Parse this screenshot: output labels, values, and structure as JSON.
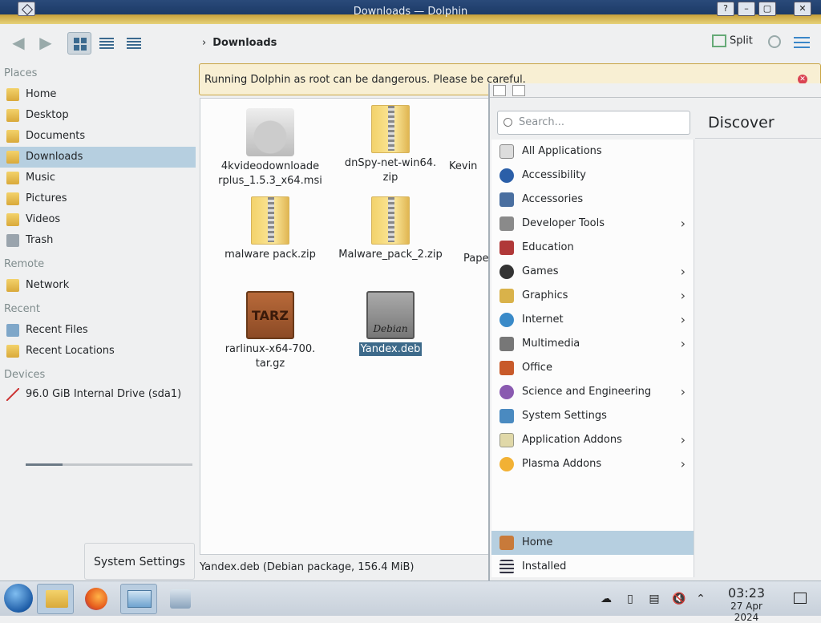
{
  "window": {
    "title": "Downloads — Dolphin"
  },
  "toolbar": {
    "breadcrumb": "Downloads",
    "split_label": "Split"
  },
  "sidebar": {
    "sections": [
      "Places",
      "Remote",
      "Recent",
      "Devices"
    ],
    "places": [
      "Home",
      "Desktop",
      "Documents",
      "Downloads",
      "Music",
      "Pictures",
      "Videos",
      "Trash"
    ],
    "remote": [
      "Network"
    ],
    "recent": [
      "Recent Files",
      "Recent Locations"
    ],
    "devices": [
      "96.0 GiB Internal Drive (sda1)"
    ],
    "selected": "Downloads",
    "drive_used_fraction": 0.22
  },
  "warning": {
    "text": "Running Dolphin as root can be dangerous. Please be careful."
  },
  "files": [
    {
      "line1": "4kvideodownloade",
      "line2": "rplus_1.5.3_x64.msi",
      "type": "msi"
    },
    {
      "line1": "dnSpy-net-win64.",
      "line2": "zip",
      "type": "zip"
    },
    {
      "line1": "Kevin",
      "line2": "",
      "type": "partial"
    },
    {
      "line1": "malware pack.zip",
      "line2": "",
      "type": "zip"
    },
    {
      "line1": "Malware_pack_2.zip",
      "line2": "",
      "type": "zip"
    },
    {
      "line1": "Paper",
      "line2": "",
      "type": "partial"
    },
    {
      "line1": "rarlinux-x64-700.",
      "line2": "tar.gz",
      "type": "tar",
      "icon_text": "TARZ"
    },
    {
      "line1": "Yandex.deb",
      "line2": "",
      "type": "deb",
      "icon_text": "Debian",
      "selected": true
    }
  ],
  "status": {
    "text": "Yandex.deb (Debian package, 156.4 MiB)"
  },
  "launcher": {
    "search_placeholder": "Search...",
    "discover_title": "Discover",
    "categories": [
      {
        "label": "All Applications",
        "arrow": false
      },
      {
        "label": "Accessibility",
        "arrow": false
      },
      {
        "label": "Accessories",
        "arrow": false
      },
      {
        "label": "Developer Tools",
        "arrow": true
      },
      {
        "label": "Education",
        "arrow": false
      },
      {
        "label": "Games",
        "arrow": true
      },
      {
        "label": "Graphics",
        "arrow": true
      },
      {
        "label": "Internet",
        "arrow": true
      },
      {
        "label": "Multimedia",
        "arrow": true
      },
      {
        "label": "Office",
        "arrow": false
      },
      {
        "label": "Science and Engineering",
        "arrow": true
      },
      {
        "label": "System Settings",
        "arrow": false
      },
      {
        "label": "Application Addons",
        "arrow": true
      },
      {
        "label": "Plasma Addons",
        "arrow": true
      }
    ],
    "bottom": [
      {
        "label": "Home",
        "selected": true
      },
      {
        "label": "Installed",
        "selected": false
      }
    ]
  },
  "tooltip": {
    "text": "System Settings"
  },
  "taskbar": {
    "time": "03:23",
    "date": "27 Apr 2024"
  }
}
